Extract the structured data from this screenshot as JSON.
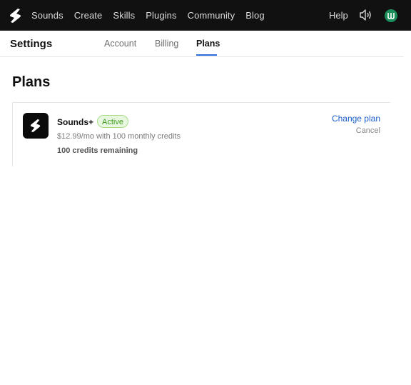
{
  "topbar": {
    "logo_icon": "sounds-logo-icon",
    "nav": [
      "Sounds",
      "Create",
      "Skills",
      "Plugins",
      "Community",
      "Blog"
    ],
    "help_label": "Help",
    "sound_icon": "speaker-icon",
    "avatar_icon": "avatar-icon",
    "avatar_color": "#1a8f5c"
  },
  "settings": {
    "title": "Settings",
    "tabs": [
      "Account",
      "Billing",
      "Plans"
    ],
    "active_tab": "Plans"
  },
  "main": {
    "heading": "Plans",
    "plan": {
      "name": "Sounds+",
      "status": "Active",
      "price_text": "$12.99/mo with 100 monthly credits",
      "credits_text": "100 credits remaining",
      "change_label": "Change plan",
      "cancel_label": "Cancel"
    }
  },
  "colors": {
    "topbar_bg": "#111111",
    "accent": "#2b6cdb",
    "link": "#1d5fcf",
    "badge_bg": "#e8f7df",
    "badge_text": "#3f9b1f"
  }
}
